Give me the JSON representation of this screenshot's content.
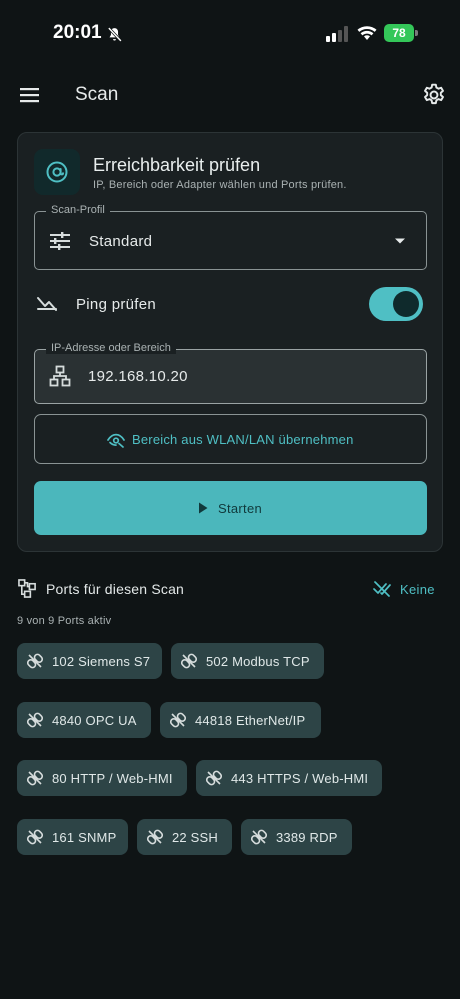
{
  "status_bar": {
    "time": "20:01",
    "battery": "78"
  },
  "app_bar": {
    "title": "Scan"
  },
  "card": {
    "title": "Erreichbarkeit prüfen",
    "subtitle": "IP, Bereich oder Adapter wählen und Ports prüfen.",
    "profile": {
      "label": "Scan-Profil",
      "value": "Standard"
    },
    "ping": {
      "label": "Ping prüfen",
      "enabled": true
    },
    "ip": {
      "label": "IP-Adresse oder Bereich",
      "value": "192.168.10.20"
    },
    "range_button": "Bereich aus WLAN/LAN übernehmen",
    "start_button": "Starten"
  },
  "ports": {
    "title": "Ports für diesen Scan",
    "none_label": "Keine",
    "count_text": "9 von 9 Ports aktiv",
    "items": [
      {
        "label": "102 Siemens S7"
      },
      {
        "label": "502 Modbus TCP"
      },
      {
        "label": "4840 OPC UA"
      },
      {
        "label": "44818 EtherNet/IP"
      },
      {
        "label": "80 HTTP / Web-HMI"
      },
      {
        "label": "443 HTTPS / Web-HMI"
      },
      {
        "label": "161 SNMP"
      },
      {
        "label": "22 SSH"
      },
      {
        "label": "3389 RDP"
      }
    ]
  },
  "colors": {
    "accent": "#4fbfc4",
    "background": "#0f1415",
    "card": "#1a2022",
    "chip": "#2d4446"
  },
  "icons": [
    "bell-muted-icon",
    "signal-icon",
    "wifi-icon",
    "menu-icon",
    "gear-icon",
    "at-sign-icon",
    "tune-icon",
    "dropdown-arrow-icon",
    "ping-icon",
    "network-tree-icon",
    "eye-icon",
    "play-icon",
    "ports-icon",
    "deselect-icon",
    "link-icon"
  ]
}
